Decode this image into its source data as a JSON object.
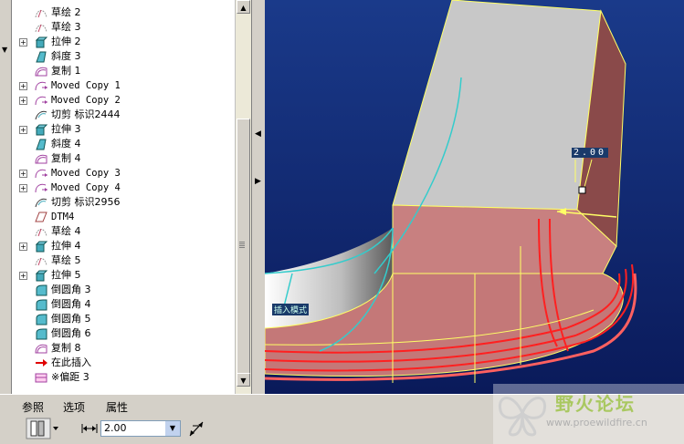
{
  "tree": {
    "items": [
      {
        "label": "草绘 2",
        "icon": "sketch-icon",
        "expandable": false
      },
      {
        "label": "草绘 3",
        "icon": "sketch-icon",
        "expandable": false
      },
      {
        "label": "拉伸 2",
        "icon": "extrude-icon",
        "expandable": true
      },
      {
        "label": "斜度 3",
        "icon": "draft-icon",
        "expandable": false
      },
      {
        "label": "复制 1",
        "icon": "copy-icon",
        "expandable": false
      },
      {
        "label": "Moved Copy 1",
        "icon": "moved-copy-icon",
        "expandable": true
      },
      {
        "label": "Moved Copy 2",
        "icon": "moved-copy-icon",
        "expandable": true
      },
      {
        "label": "切剪 标识2444",
        "icon": "cut-icon",
        "expandable": false
      },
      {
        "label": "拉伸 3",
        "icon": "extrude-icon",
        "expandable": true
      },
      {
        "label": "斜度 4",
        "icon": "draft-icon",
        "expandable": false
      },
      {
        "label": "复制 4",
        "icon": "copy-icon",
        "expandable": false
      },
      {
        "label": "Moved Copy 3",
        "icon": "moved-copy-icon",
        "expandable": true
      },
      {
        "label": "Moved Copy 4",
        "icon": "moved-copy-icon",
        "expandable": true
      },
      {
        "label": "切剪 标识2956",
        "icon": "cut-icon",
        "expandable": false
      },
      {
        "label": "DTM4",
        "icon": "datum-plane-icon",
        "expandable": false
      },
      {
        "label": "草绘 4",
        "icon": "sketch-icon",
        "expandable": false
      },
      {
        "label": "拉伸 4",
        "icon": "extrude-icon",
        "expandable": true
      },
      {
        "label": "草绘 5",
        "icon": "sketch-icon",
        "expandable": false
      },
      {
        "label": "拉伸 5",
        "icon": "extrude-icon",
        "expandable": true
      },
      {
        "label": "倒圆角 3",
        "icon": "round-icon",
        "expandable": false
      },
      {
        "label": "倒圆角 4",
        "icon": "round-icon",
        "expandable": false
      },
      {
        "label": "倒圆角 5",
        "icon": "round-icon",
        "expandable": false
      },
      {
        "label": "倒圆角 6",
        "icon": "round-icon",
        "expandable": false
      },
      {
        "label": "复制 8",
        "icon": "copy-icon",
        "expandable": false
      },
      {
        "label": "在此插入",
        "icon": "insert-here-arrow-icon",
        "expandable": false
      },
      {
        "label": "※偏距 3",
        "icon": "offset-icon",
        "expandable": false
      }
    ]
  },
  "viewport": {
    "dimension_label": "2.00",
    "tag_label": "插入模式"
  },
  "dashboard": {
    "tabs": [
      "参照",
      "选项",
      "属性"
    ],
    "thickness_value": "2.00"
  },
  "watermark": {
    "title": "野火论坛",
    "url": "www.proewildfire.cn"
  },
  "colors": {
    "viewport_top": "#1a3a8a",
    "viewport_bottom": "#0a1a5a",
    "part_red": "#c97a7a",
    "part_gray": "#b8b8b8",
    "edge_yellow": "#ffff66",
    "highlight_red": "#ff2020",
    "insert_arrow": "#e00000"
  }
}
